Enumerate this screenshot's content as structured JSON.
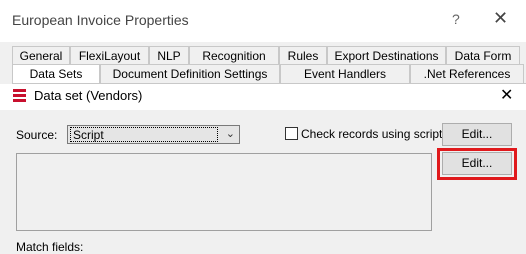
{
  "outer_window": {
    "title": "European Invoice Properties",
    "help_glyph": "?",
    "close_glyph": "✕"
  },
  "tabs_row1": [
    "General",
    "FlexiLayout",
    "NLP",
    "Recognition",
    "Rules",
    "Export Destinations",
    "Data Form"
  ],
  "tabs_row2": [
    "Data Sets",
    "Document Definition Settings",
    "Event Handlers",
    ".Net References"
  ],
  "dialog": {
    "title": "Data set (Vendors)",
    "close_glyph": "✕",
    "source_label": "Source:",
    "source_value": "Script",
    "check_label": "Check records using scripts",
    "check_checked": false,
    "edit_button_1": "Edit...",
    "edit_button_2": "Edit...",
    "match_fields_label": "Match  fields:"
  },
  "colors": {
    "highlight": "#e0191c",
    "icon_red": "#c8102e"
  },
  "icons": {
    "dialog_icon": "stacked-layers-icon",
    "dropdown": "chevron-down-icon"
  }
}
